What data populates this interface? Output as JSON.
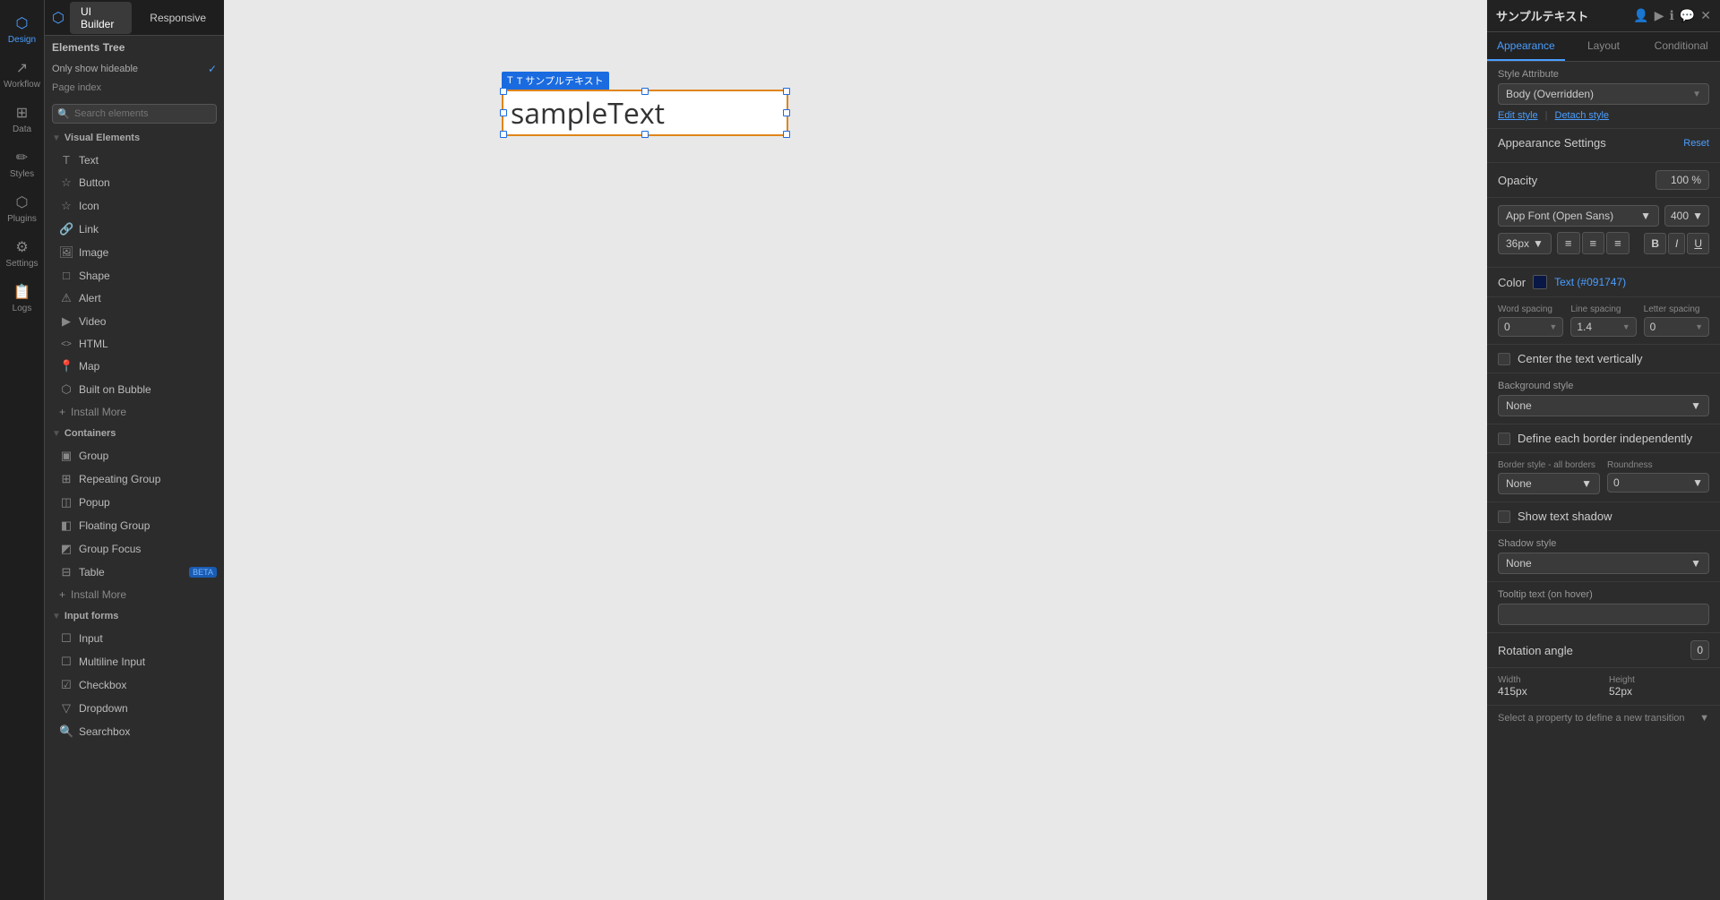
{
  "app": {
    "title": "サンプルテキスト"
  },
  "topbar": {
    "tab_ui_builder": "UI Builder",
    "tab_responsive": "Responsive"
  },
  "nav": {
    "items": [
      {
        "id": "design",
        "label": "Design",
        "icon": "⬡",
        "active": true
      },
      {
        "id": "workflow",
        "label": "Workflow",
        "icon": "↗"
      },
      {
        "id": "data",
        "label": "Data",
        "icon": "⊞"
      },
      {
        "id": "styles",
        "label": "Styles",
        "icon": "✏"
      },
      {
        "id": "plugins",
        "label": "Plugins",
        "icon": "⬡"
      },
      {
        "id": "settings",
        "label": "Settings",
        "icon": "⚙"
      },
      {
        "id": "logs",
        "label": "Logs",
        "icon": "📋"
      }
    ]
  },
  "elements_tree": {
    "header": "Elements Tree",
    "only_show_hideable": "Only show hideable",
    "page_index": "Page index",
    "search_placeholder": "Search elements"
  },
  "visual_elements": {
    "header": "Visual Elements",
    "items": [
      {
        "name": "Text",
        "icon": "T"
      },
      {
        "name": "Button",
        "icon": "☆"
      },
      {
        "name": "Icon",
        "icon": "☆"
      },
      {
        "name": "Link",
        "icon": "🔗"
      },
      {
        "name": "Image",
        "icon": "🖼"
      },
      {
        "name": "Shape",
        "icon": "□"
      },
      {
        "name": "Alert",
        "icon": "⚠"
      },
      {
        "name": "Video",
        "icon": "▶"
      },
      {
        "name": "HTML",
        "icon": "<>"
      },
      {
        "name": "Map",
        "icon": "📍"
      },
      {
        "name": "Built on Bubble",
        "icon": "⬡"
      },
      {
        "name": "Install More",
        "icon": "+"
      }
    ]
  },
  "containers": {
    "header": "Containers",
    "items": [
      {
        "name": "Group",
        "icon": "▣"
      },
      {
        "name": "Repeating Group",
        "icon": "⊞"
      },
      {
        "name": "Popup",
        "icon": "◫"
      },
      {
        "name": "Floating Group",
        "icon": "◧"
      },
      {
        "name": "Group Focus",
        "icon": "◩"
      },
      {
        "name": "Table",
        "icon": "⊟",
        "badge": "BETA"
      },
      {
        "name": "Install More",
        "icon": "+"
      }
    ]
  },
  "input_forms": {
    "header": "Input forms",
    "items": [
      {
        "name": "Input",
        "icon": "☐"
      },
      {
        "name": "Multiline Input",
        "icon": "☐"
      },
      {
        "name": "Checkbox",
        "icon": "☑"
      },
      {
        "name": "Dropdown",
        "icon": "▽"
      },
      {
        "name": "Searchbox",
        "icon": "🔍"
      }
    ]
  },
  "canvas": {
    "element_label": "T サンプルテキスト",
    "sample_text": "sampleText"
  },
  "right_panel": {
    "title": "サンプルテキスト",
    "tabs": [
      "Appearance",
      "Layout",
      "Conditional"
    ],
    "active_tab": "Appearance",
    "style_attribute_label": "Style Attribute",
    "style_value": "Body (Overridden)",
    "edit_style": "Edit style",
    "detach_style": "Detach style",
    "appearance_settings": "Appearance Settings",
    "reset": "Reset",
    "opacity_label": "Opacity",
    "opacity_value": "100 %",
    "font_family": "App Font (Open Sans)",
    "font_weight": "400",
    "font_size": "36px",
    "align_left": "≡",
    "align_center": "≡",
    "align_right": "≡",
    "bold": "B",
    "italic": "I",
    "underline": "U",
    "color_label": "Color",
    "color_hex": "#091747",
    "color_text": "Text (#091747)",
    "word_spacing_label": "Word spacing",
    "line_spacing_label": "Line spacing",
    "letter_spacing_label": "Letter spacing",
    "word_spacing_value": "0",
    "line_spacing_value": "1.4",
    "letter_spacing_value": "0",
    "center_vertical": "Center the text vertically",
    "bg_style_label": "Background style",
    "bg_style_value": "None",
    "define_border": "Define each border independently",
    "border_style_label": "Border style - all borders",
    "roundness_label": "Roundness",
    "border_value": "None",
    "roundness_value": "0",
    "show_shadow": "Show text shadow",
    "shadow_style_label": "Shadow style",
    "shadow_value": "None",
    "tooltip_label": "Tooltip text (on hover)",
    "rotation_label": "Rotation angle",
    "rotation_value": "0",
    "width_label": "Width",
    "width_value": "415px",
    "height_label": "Height",
    "height_value": "52px",
    "transition_label": "Select a property to define a new transition"
  }
}
